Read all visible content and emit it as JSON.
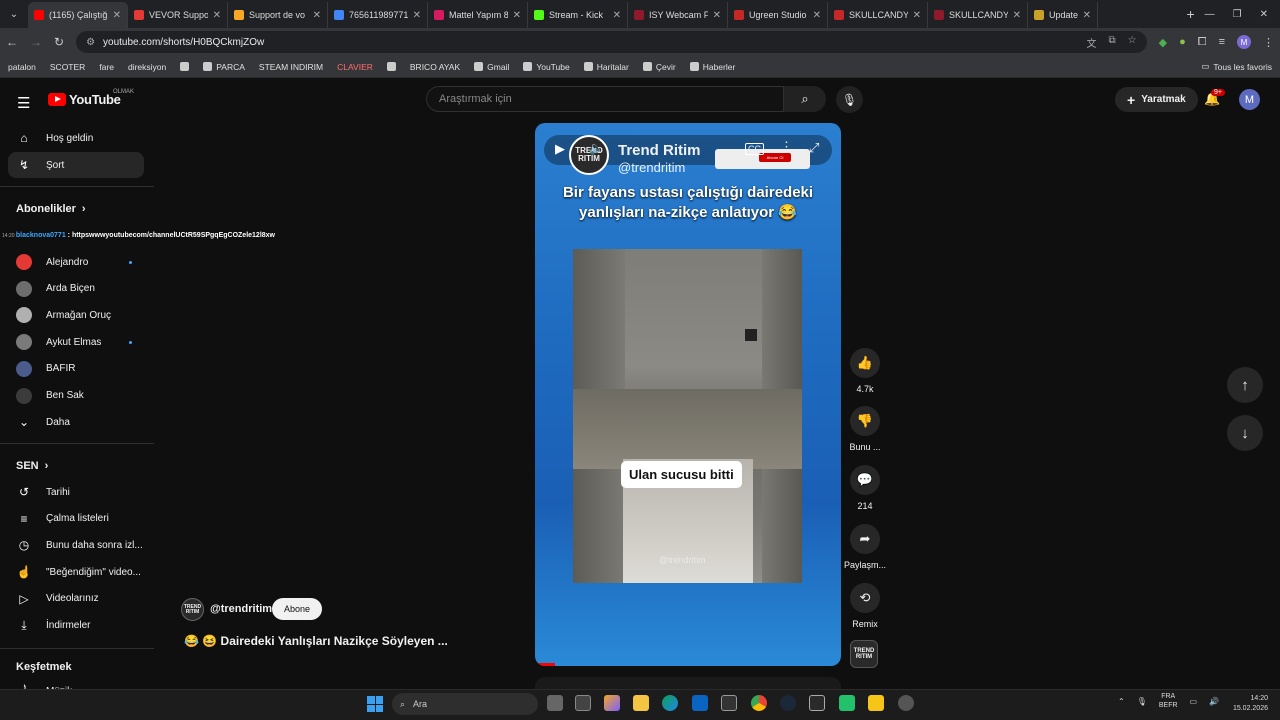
{
  "browser": {
    "tabs": [
      {
        "title": "(1165) Çalıştığ",
        "color": "#ff0000",
        "active": true
      },
      {
        "title": "VEVOR Suppo",
        "color": "#e53935"
      },
      {
        "title": "Support de vo",
        "color": "#f9a825"
      },
      {
        "title": "765611989771",
        "color": "#4285f4"
      },
      {
        "title": "Mattel Yapım 8",
        "color": "#d81b60"
      },
      {
        "title": "Stream - Kick",
        "color": "#53fc18"
      },
      {
        "title": "ISY Webcam F",
        "color": "#8e1a2c"
      },
      {
        "title": "Ugreen Studio",
        "color": "#c62828"
      },
      {
        "title": "SKULLCANDY",
        "color": "#c62828"
      },
      {
        "title": "SKULLCANDY",
        "color": "#8e1a2c"
      },
      {
        "title": "Update",
        "color": "#c9a227"
      }
    ],
    "url": "youtube.com/shorts/H0BQCkmjZOw",
    "bookmarks": [
      {
        "label": "patalon",
        "icon": false
      },
      {
        "label": "SCOTER",
        "icon": false
      },
      {
        "label": "fare",
        "icon": false
      },
      {
        "label": "direksiyon",
        "icon": false
      },
      {
        "label": "",
        "icon": true
      },
      {
        "label": "PARCA",
        "icon": true
      },
      {
        "label": "STEAM INDIRIM",
        "icon": false
      },
      {
        "label": "CLAVIER",
        "icon": false,
        "color": "#ff6d6d"
      },
      {
        "label": "",
        "icon": true
      },
      {
        "label": "BRICO AYAK",
        "icon": false
      },
      {
        "label": "Gmail",
        "icon": true
      },
      {
        "label": "YouTube",
        "icon": true
      },
      {
        "label": "Haritalar",
        "icon": true
      },
      {
        "label": "Çevir",
        "icon": true
      },
      {
        "label": "Haberler",
        "icon": true
      }
    ],
    "all_bookmarks": "Tous les favoris"
  },
  "header": {
    "logo_word": "YouTube",
    "logo_sup": "OLMAK",
    "search_placeholder": "Araştırmak için",
    "create_label": "Yaratmak",
    "notif_count": "9+",
    "avatar_letter": "M"
  },
  "sidebar": {
    "main": [
      {
        "label": "Hoş geldin",
        "icon": "⌂"
      },
      {
        "label": "Şort",
        "icon": "↯",
        "active": true
      }
    ],
    "subs_heading": "Abonelikler",
    "tooltip": {
      "prefix": "blacknova0771",
      "url": "httpswwwyoutubecom/channelUCtR59SPgqEgCOZele12l8xw"
    },
    "subs": [
      {
        "label": "Alejandro",
        "color": "#e53935",
        "dot": true
      },
      {
        "label": "Arda Biçen",
        "color": "#6d6d6d"
      },
      {
        "label": "Armağan Oruç",
        "color": "#b0b0b0"
      },
      {
        "label": "Aykut Elmas",
        "color": "#7a7a7a",
        "dot": true
      },
      {
        "label": "BAFIR",
        "color": "#4a5b8c"
      },
      {
        "label": "Ben Sak",
        "color": "#3b3b3b"
      }
    ],
    "more_label": "Daha",
    "you_heading": "SEN",
    "you_items": [
      {
        "label": "Tarihi",
        "icon": "↺"
      },
      {
        "label": "Çalma listeleri",
        "icon": "≡"
      },
      {
        "label": "Bunu daha sonra izl...",
        "icon": "◷"
      },
      {
        "label": "\"Beğendiğim\" video...",
        "icon": "☝"
      },
      {
        "label": "Videolarınız",
        "icon": "▷"
      },
      {
        "label": "İndirmeler",
        "icon": "⤓"
      }
    ],
    "explore_heading": "Keşfetmek",
    "explore_partial": "Müzik"
  },
  "short": {
    "channel_logo": "TREND RITIM",
    "channel_name": "Trend Ritim",
    "channel_handle": "@trendritim",
    "headline": "Bir fayans ustası çalıştığı dairedeki yanlışları na-zikçe anlatıyor 😂",
    "caption": "Ulan sucusu bitti",
    "watermark": "@trendritim",
    "sub_label": "Abone Ol"
  },
  "actions": {
    "like_count": "4.7k",
    "dislike_label": "Bunu ...",
    "comment_count": "214",
    "share_label": "Paylaşm...",
    "remix_label": "Remix"
  },
  "meta": {
    "handle": "@trendritim",
    "subscribe_label": "Abone",
    "title": "😂 😆 Dairedeki Yanlışları Nazikçe Söyleyen ..."
  },
  "taskbar": {
    "search_label": "Ara",
    "lang_top": "FRA",
    "lang_bottom": "BEFR",
    "time": "14:20",
    "date": "15.02.2026"
  }
}
